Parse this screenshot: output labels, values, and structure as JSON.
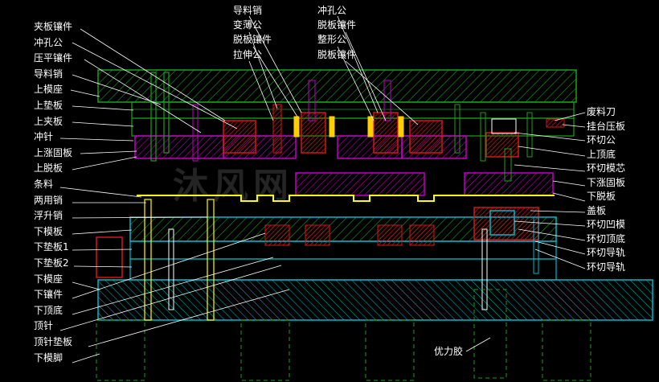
{
  "labels_left": [
    "夹板镶件",
    "冲孔公",
    "压平镶件",
    "导料销",
    "上模座",
    "上垫板",
    "上夹板",
    "冲针",
    "上涨固板",
    "上脱板",
    "条料",
    "两用销",
    "浮升销",
    "下模板",
    "下垫板1",
    "下垫板2",
    "下模座",
    "下镶件",
    "下顶底",
    "顶针",
    "顶针垫板",
    "下模脚"
  ],
  "labels_top_left": [
    "导料销",
    "变薄公",
    "脱板镶件",
    "拉伸公"
  ],
  "labels_top_right": [
    "冲孔公",
    "脱板镶件",
    "整形公",
    "脱板镶件"
  ],
  "labels_right": [
    "废料刀",
    "挂台压板",
    "环切公",
    "上顶底",
    "环切模芯",
    "下涨固板",
    "下脱板",
    "盖板",
    "环切凹模",
    "环切顶底",
    "环切导轨",
    "环切导轨"
  ],
  "label_inner": "优力胶",
  "watermark": "沐风网",
  "colors": {
    "background": "#000000",
    "upper_holder": "#1f9d1f",
    "plates": "#c000c0",
    "lower_plates": "#00b7c8",
    "strip": "#ffff00",
    "lines": "#ffffff",
    "parts_red": "#d01818"
  }
}
